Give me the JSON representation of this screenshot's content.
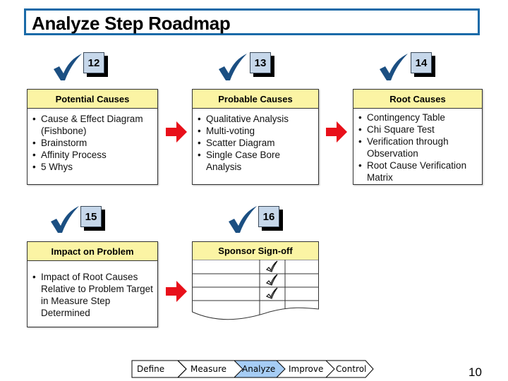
{
  "title": "Analyze Step Roadmap",
  "colors": {
    "title_border": "#1a6aa8",
    "card_header": "#fbf4a4",
    "number_box": "#c6d7ea",
    "check": "#1b4f82",
    "arrow": "#e8101a",
    "phase_active": "#a6cdf5"
  },
  "steps": [
    {
      "number": "12",
      "heading": "Potential Causes",
      "items": [
        "Cause & Effect Diagram (Fishbone)",
        "Brainstorm",
        "Affinity Process",
        "5 Whys"
      ]
    },
    {
      "number": "13",
      "heading": "Probable Causes",
      "items": [
        "Qualitative Analysis",
        "Multi-voting",
        "Scatter Diagram",
        "Single Case Bore Analysis"
      ]
    },
    {
      "number": "14",
      "heading": "Root Causes",
      "items": [
        "Contingency Table",
        "Chi Square Test",
        "Verification through Observation",
        "Root Cause Verification Matrix"
      ]
    },
    {
      "number": "15",
      "heading": "Impact on Problem",
      "items": [
        "Impact of Root Causes Relative to Problem Target in Measure Step Determined"
      ]
    },
    {
      "number": "16",
      "heading": "Sponsor Sign-off",
      "items": []
    }
  ],
  "signoff_rows": 3,
  "phases": [
    "Define",
    "Measure",
    "Analyze",
    "Improve",
    "Control"
  ],
  "active_phase": "Analyze",
  "page_number": "10"
}
